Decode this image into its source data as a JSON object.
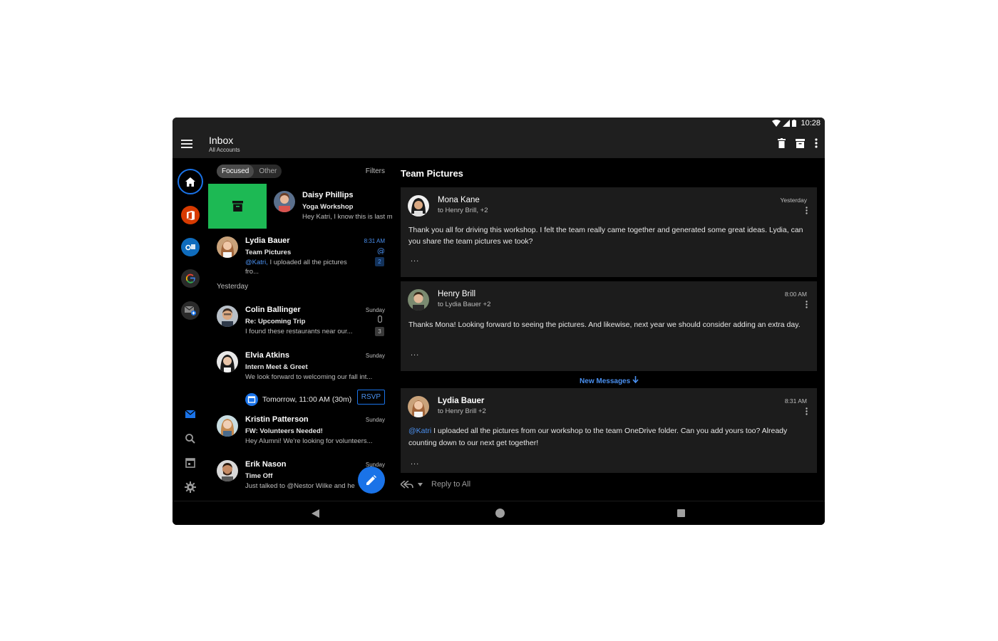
{
  "status_bar": {
    "time": "10:28"
  },
  "app_bar": {
    "title": "Inbox",
    "subtitle": "All Accounts"
  },
  "list": {
    "tabs": [
      {
        "label": "Focused",
        "active": true
      },
      {
        "label": "Other",
        "active": false
      }
    ],
    "filters_label": "Filters",
    "items": [
      {
        "sender": "Daisy Phillips",
        "subject": "Yoga Workshop",
        "preview": "Hey Katri, I know this is last mi"
      },
      {
        "sender": "Lydia Bauer",
        "subject": "Team Pictures",
        "mention": "@Katri,",
        "preview": " I uploaded all the pictures",
        "preview2": "fro...",
        "time": "8:31 AM",
        "count": "2"
      },
      {
        "sender": "Colin Ballinger",
        "subject": "Re: Upcoming Trip",
        "preview": "I found these restaurants near our...",
        "time": "Sunday",
        "count": "3"
      },
      {
        "sender": "Elvia Atkins",
        "subject": "Intern Meet & Greet",
        "preview": "We look forward to welcoming our fall int...",
        "time": "Sunday",
        "event": "Tomorrow, 11:00 AM (30m)",
        "rsvp": "RSVP"
      },
      {
        "sender": "Kristin Patterson",
        "subject": "FW: Volunteers Needed!",
        "preview": "Hey Alumni! We're looking for volunteers...",
        "time": "Sunday"
      },
      {
        "sender": "Erik Nason",
        "subject": "Time Off",
        "preview": "Just talked to @Nestor Wilke and he",
        "time": "Sunday"
      }
    ],
    "section_yesterday": "Yesterday"
  },
  "detail": {
    "title": "Team Pictures",
    "messages": [
      {
        "sender": "Mona Kane",
        "to": "to Henry Brill, +2",
        "time": "Yesterday",
        "body": "Thank you all for driving this workshop. I felt the team really came together and generated some great ideas. Lydia, can you share the team pictures we took?"
      },
      {
        "sender": "Henry Brill",
        "to": "to Lydia Bauer +2",
        "time": "8:00 AM",
        "body": "Thanks Mona! Looking forward to seeing the pictures. And likewise, next year we should consider adding an extra day."
      },
      {
        "sender": "Lydia Bauer",
        "to": "to Henry Brill +2",
        "time": "8:31 AM",
        "mention": "@Katri",
        "body": " I uploaded all the pictures from our workshop to the team OneDrive folder. Can you add yours too? Already counting down to our next get together!"
      }
    ],
    "ellipsis": "...",
    "new_messages": "New Messages",
    "reply_label": "Reply to All"
  },
  "colors": {
    "accent": "#1a73e8",
    "swipe_archive": "#1db954",
    "office": "#d83b01",
    "outlook": "#0f6cbd"
  },
  "icons": [
    "menu-icon",
    "trash-icon",
    "archive-icon",
    "more-vert-icon",
    "home-icon",
    "office-icon",
    "outlook-icon",
    "google-icon",
    "mail-add-icon",
    "mail-icon",
    "search-icon",
    "calendar-icon",
    "settings-icon",
    "edit-icon",
    "reply-all-icon"
  ]
}
